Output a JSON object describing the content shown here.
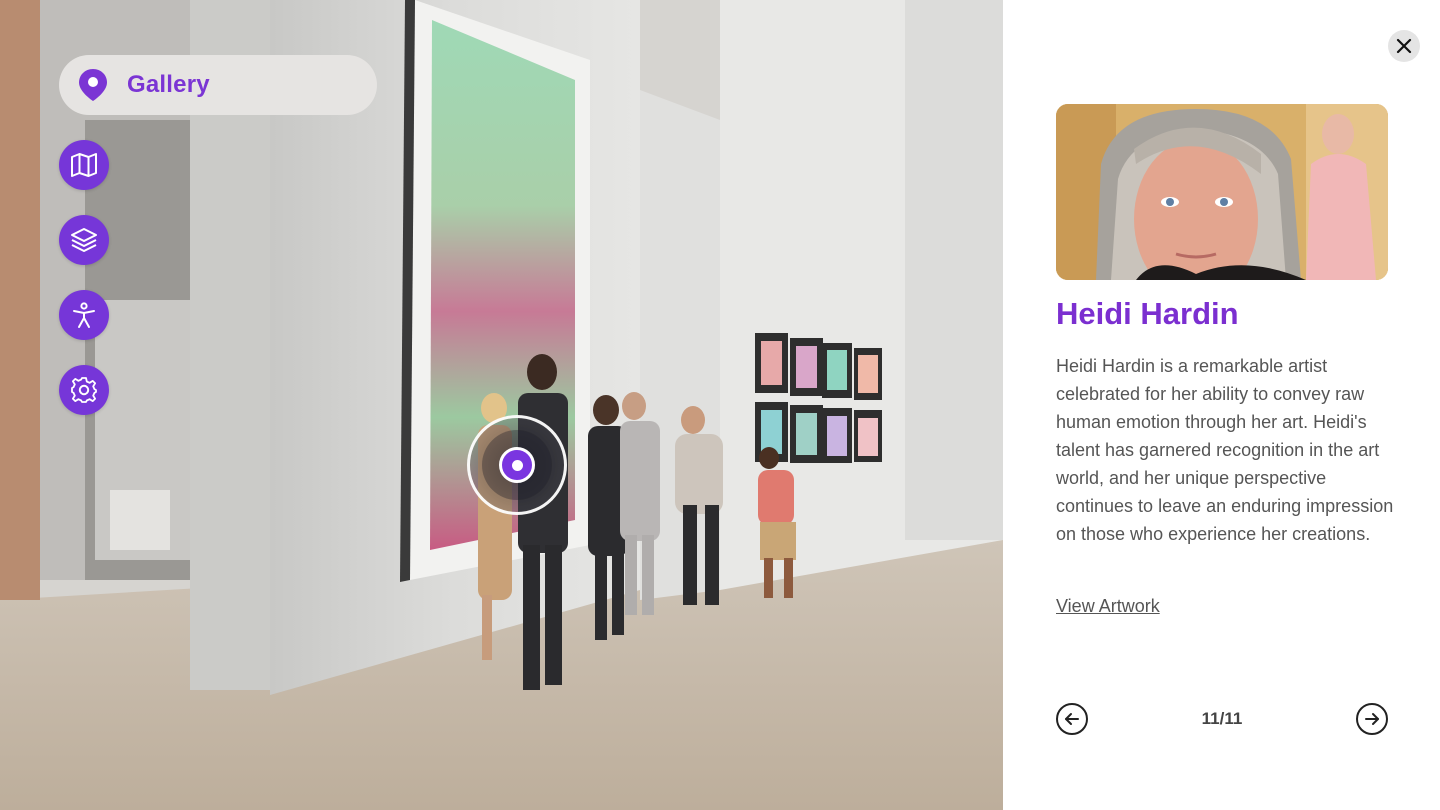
{
  "location": {
    "label": "Gallery",
    "icon": "map-pin-icon"
  },
  "tools": [
    {
      "icon": "map-icon"
    },
    {
      "icon": "layers-icon"
    },
    {
      "icon": "accessibility-icon"
    },
    {
      "icon": "gear-icon"
    }
  ],
  "hotspot": {
    "icon": "target-icon"
  },
  "panel": {
    "close_icon": "close-icon",
    "artist_name": "Heidi Hardin",
    "bio": "Heidi Hardin is a remarkable artist celebrated for her ability to convey raw human emotion through her art. Heidi's talent has garnered recognition in the art world, and her unique perspective continues to leave an enduring impression on those who experience her creations.",
    "link_label": "View Artwork",
    "pager": {
      "count": "11/11",
      "prev_icon": "arrow-left-circle-icon",
      "next_icon": "arrow-right-circle-icon"
    }
  },
  "colors": {
    "accent": "#7636d8",
    "name_color": "#7b2fd0",
    "text": "#555555"
  }
}
